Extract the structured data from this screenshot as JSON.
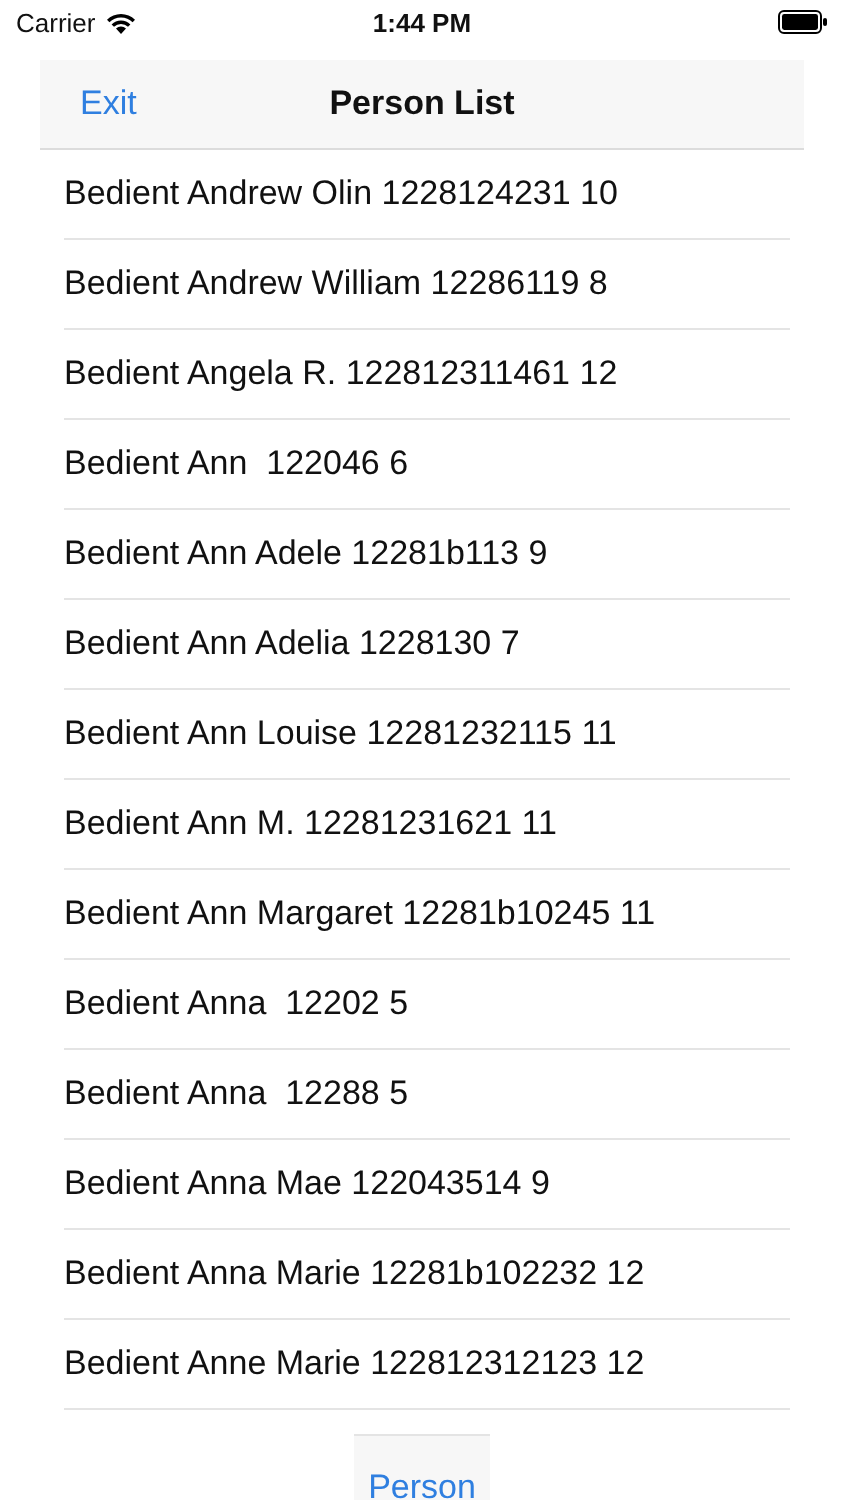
{
  "status_bar": {
    "carrier": "Carrier",
    "time": "1:44 PM"
  },
  "nav_bar": {
    "back_button": "Exit",
    "title": "Person List"
  },
  "rows": [
    "Bedient Andrew Olin 1228124231 10",
    "Bedient Andrew William 12286119 8",
    "Bedient Angela R. 122812311461 12",
    "Bedient Ann  122046 6",
    "Bedient Ann Adele 12281b113 9",
    "Bedient Ann Adelia 1228130 7",
    "Bedient Ann Louise 12281232115 11",
    "Bedient Ann M. 12281231621 11",
    "Bedient Ann Margaret 12281b10245 11",
    "Bedient Anna  12202 5",
    "Bedient Anna  12288 5",
    "Bedient Anna Mae 122043514 9",
    "Bedient Anna Marie 12281b102232 12",
    "Bedient Anne Marie 122812312123 12"
  ],
  "bottom_button": "Person"
}
